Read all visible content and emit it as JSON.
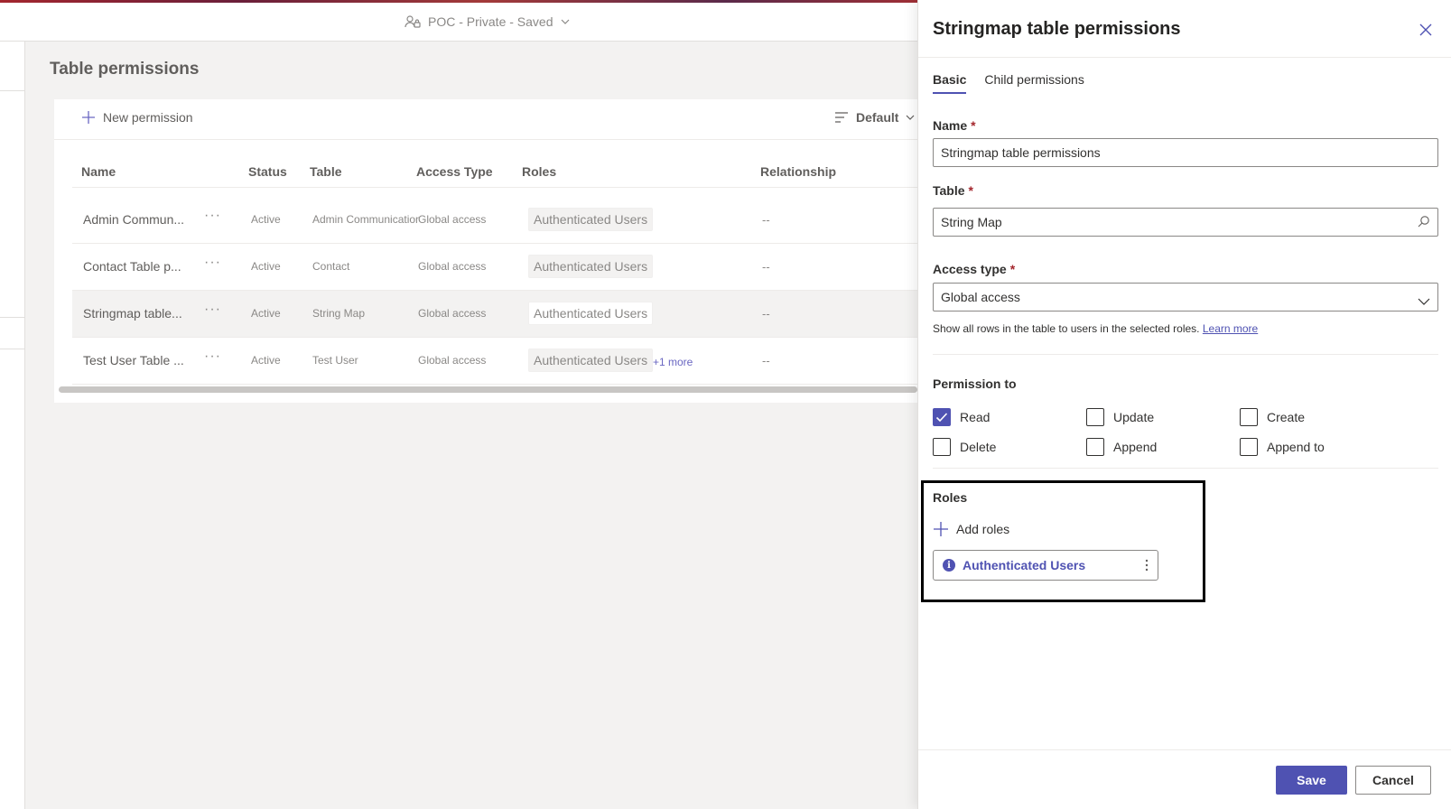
{
  "header": {
    "site_label": "POC - Private - Saved"
  },
  "page": {
    "title": "Table permissions"
  },
  "toolbar": {
    "new_permission_label": "New permission",
    "view_label": "Default"
  },
  "grid": {
    "columns": [
      "Name",
      "Status",
      "Table",
      "Access Type",
      "Roles",
      "Relationship"
    ],
    "rows": [
      {
        "name": "Admin Commun...",
        "status": "Active",
        "table": "Admin Communication",
        "access": "Global access",
        "role": "Authenticated Users",
        "more": "",
        "relationship": "--"
      },
      {
        "name": "Contact Table p...",
        "status": "Active",
        "table": "Contact",
        "access": "Global access",
        "role": "Authenticated Users",
        "more": "",
        "relationship": "--"
      },
      {
        "name": "Stringmap table...",
        "status": "Active",
        "table": "String Map",
        "access": "Global access",
        "role": "Authenticated Users",
        "more": "",
        "relationship": "--"
      },
      {
        "name": "Test User Table ...",
        "status": "Active",
        "table": "Test User",
        "access": "Global access",
        "role": "Authenticated Users",
        "more": "+1 more",
        "relationship": "--"
      }
    ],
    "more_actions_glyph": "···"
  },
  "panel": {
    "title": "Stringmap table permissions",
    "tabs": [
      {
        "label": "Basic",
        "active": true
      },
      {
        "label": "Child permissions",
        "active": false
      }
    ],
    "name_label": "Name",
    "name_value": "Stringmap table permissions",
    "table_label": "Table",
    "table_value": "String Map",
    "access_label": "Access type",
    "access_value": "Global access",
    "required_mark": "*",
    "helper_text": "Show all rows in the table to users in the selected roles.",
    "learn_more": "Learn more",
    "permission_title": "Permission to",
    "permissions": {
      "read": {
        "label": "Read",
        "checked": true
      },
      "update": {
        "label": "Update",
        "checked": false
      },
      "create": {
        "label": "Create",
        "checked": false
      },
      "delete": {
        "label": "Delete",
        "checked": false
      },
      "append": {
        "label": "Append",
        "checked": false
      },
      "append_to": {
        "label": "Append to",
        "checked": false
      }
    },
    "roles_title": "Roles",
    "add_roles_label": "Add roles",
    "role_chip": "Authenticated Users",
    "info_glyph": "i",
    "save_label": "Save",
    "cancel_label": "Cancel"
  },
  "colors": {
    "accent": "#4f52b2",
    "required": "#a4262c"
  }
}
